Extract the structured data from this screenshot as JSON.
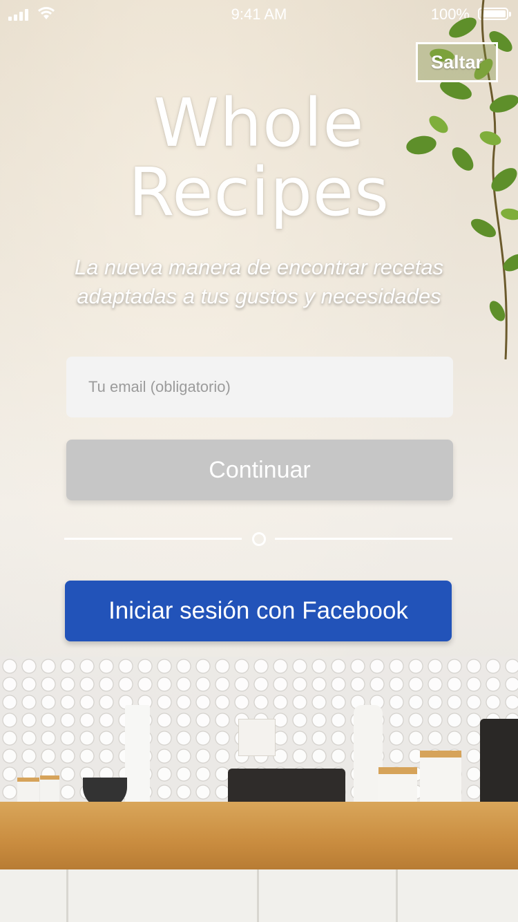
{
  "status_bar": {
    "time": "9:41 AM",
    "battery": "100%"
  },
  "header": {
    "skip_label": "Saltar"
  },
  "hero": {
    "title_line1": "Whole",
    "title_line2": "Recipes",
    "tagline_line1": "La nueva manera de encontrar recetas",
    "tagline_line2": "adaptadas a tus gustos y necesidades"
  },
  "form": {
    "email_placeholder": "Tu email (obligatorio)",
    "email_value": "",
    "continue_label": "Continuar"
  },
  "social": {
    "facebook_label": "Iniciar sesión con Facebook"
  },
  "colors": {
    "facebook": "#2253b9",
    "continue_disabled": "#c6c6c6",
    "input_bg": "#f3f3f3"
  }
}
